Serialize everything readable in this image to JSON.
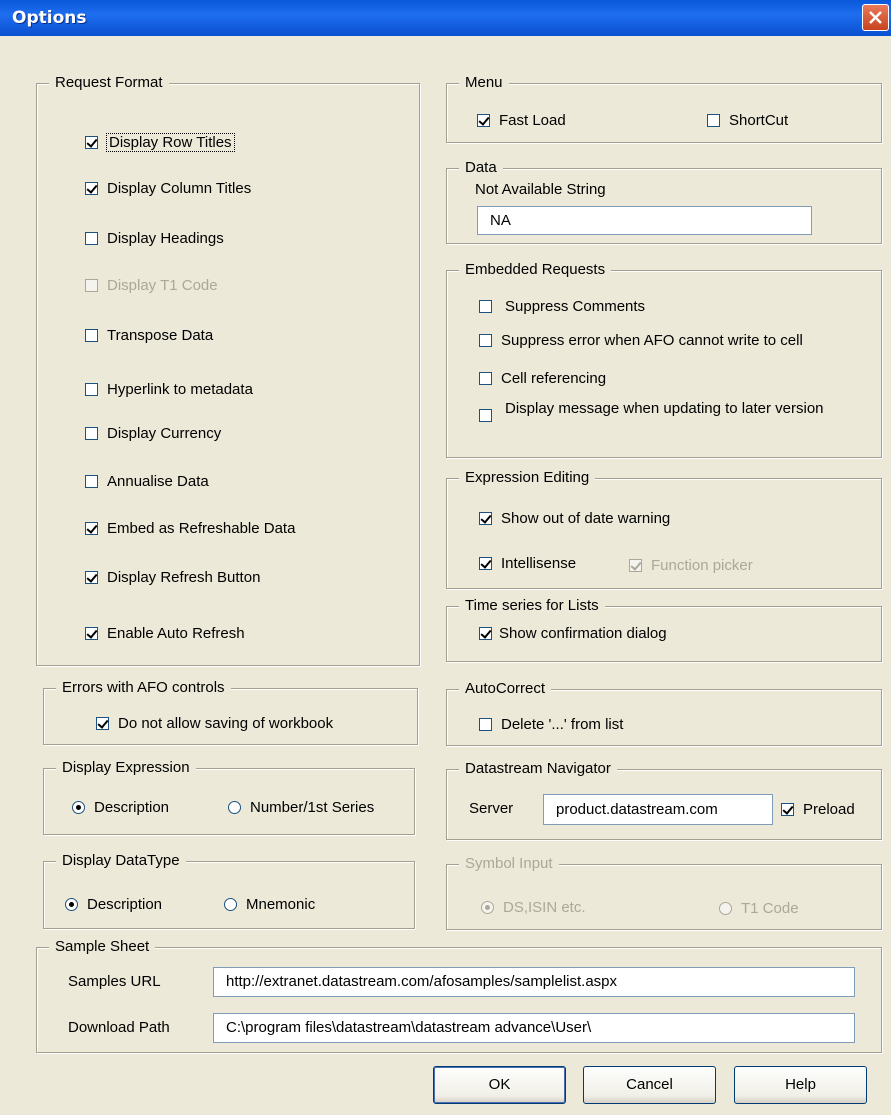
{
  "window": {
    "title": "Options"
  },
  "request_format": {
    "legend": "Request Format",
    "items": [
      {
        "label": "Display Row Titles",
        "checked": true
      },
      {
        "label": "Display Column Titles",
        "checked": true
      },
      {
        "label": "Display Headings",
        "checked": false
      },
      {
        "label": "Display T1 Code",
        "checked": false,
        "disabled": true
      },
      {
        "label": "Transpose Data",
        "checked": false
      },
      {
        "label": "Hyperlink to metadata",
        "checked": false
      },
      {
        "label": "Display Currency",
        "checked": false
      },
      {
        "label": "Annualise Data",
        "checked": false
      },
      {
        "label": "Embed as Refreshable Data",
        "checked": true
      },
      {
        "label": "Display Refresh Button",
        "checked": true
      },
      {
        "label": "Enable Auto Refresh",
        "checked": true
      }
    ]
  },
  "errors_afo": {
    "legend": "Errors with AFO controls",
    "item": {
      "label": "Do not allow saving of workbook",
      "checked": true
    }
  },
  "display_expression": {
    "legend": "Display Expression",
    "options": [
      {
        "label": "Description",
        "selected": true
      },
      {
        "label": "Number/1st Series",
        "selected": false
      }
    ]
  },
  "display_datatype": {
    "legend": "Display DataType",
    "options": [
      {
        "label": "Description",
        "selected": true
      },
      {
        "label": "Mnemonic",
        "selected": false
      }
    ]
  },
  "menu": {
    "legend": "Menu",
    "items": [
      {
        "label": "Fast Load",
        "checked": true
      },
      {
        "label": "ShortCut",
        "checked": false
      }
    ]
  },
  "data": {
    "legend": "Data",
    "na_label": "Not Available String",
    "na_value": "NA"
  },
  "embedded": {
    "legend": "Embedded Requests",
    "items": [
      {
        "label": "Suppress Comments",
        "checked": false
      },
      {
        "label": "Suppress error when AFO cannot write to cell",
        "checked": false
      },
      {
        "label": "Cell referencing",
        "checked": false
      },
      {
        "label": "Display message when updating to later version",
        "checked": false
      }
    ]
  },
  "expression_editing": {
    "legend": "Expression Editing",
    "items": [
      {
        "label": "Show out of date warning",
        "checked": true
      },
      {
        "label": "Intellisense",
        "checked": true
      },
      {
        "label": "Function picker",
        "checked": true,
        "disabled": true
      }
    ]
  },
  "time_series": {
    "legend": "Time series for Lists",
    "item": {
      "label": "Show confirmation dialog",
      "checked": true
    }
  },
  "autocorrect": {
    "legend": "AutoCorrect",
    "item": {
      "label": "Delete '...' from list",
      "checked": false
    }
  },
  "navigator": {
    "legend": "Datastream Navigator",
    "server_label": "Server",
    "server_value": "product.datastream.com",
    "preload": {
      "label": "Preload",
      "checked": true
    }
  },
  "symbol_input": {
    "legend": "Symbol Input",
    "disabled": true,
    "options": [
      {
        "label": "DS,ISIN etc.",
        "selected": true
      },
      {
        "label": "T1 Code",
        "selected": false
      }
    ]
  },
  "sample_sheet": {
    "legend": "Sample Sheet",
    "samples_url_label": "Samples URL",
    "samples_url_value": "http://extranet.datastream.com/afosamples/samplelist.aspx",
    "download_path_label": "Download Path",
    "download_path_value": "C:\\program files\\datastream\\datastream advance\\User\\"
  },
  "buttons": {
    "ok": "OK",
    "cancel": "Cancel",
    "help": "Help"
  },
  "colors": {
    "titlebar": "#0a57d9",
    "dialog_bg": "#ece9d8",
    "disabled_text": "#aca899"
  }
}
